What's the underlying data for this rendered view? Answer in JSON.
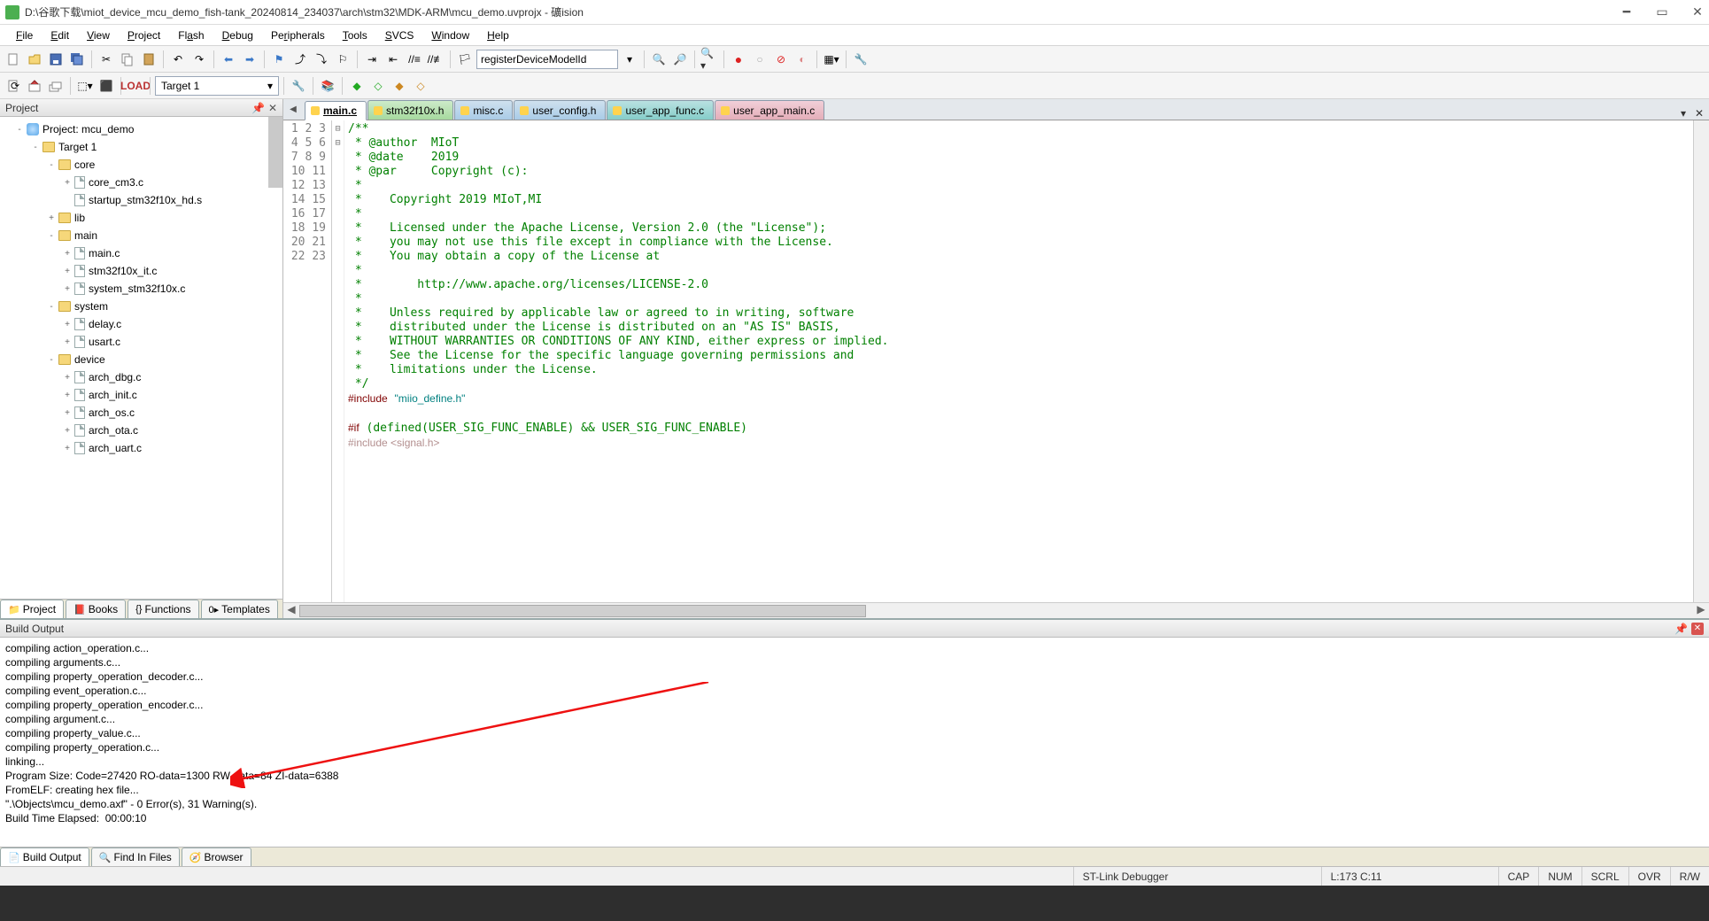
{
  "title": "D:\\谷歌下载\\miot_device_mcu_demo_fish-tank_20240814_234037\\arch\\stm32\\MDK-ARM\\mcu_demo.uvprojx - 礦ision",
  "menu": {
    "file": "File",
    "edit": "Edit",
    "view": "View",
    "project": "Project",
    "flash": "Flash",
    "debug": "Debug",
    "peripherals": "Peripherals",
    "tools": "Tools",
    "svcs": "SVCS",
    "window": "Window",
    "help": "Help"
  },
  "toolbar": {
    "findtext": "registerDeviceModelId"
  },
  "target": {
    "selected": "Target 1"
  },
  "projectPane": {
    "title": "Project",
    "tree": [
      {
        "d": 0,
        "t": "project",
        "exp": "-",
        "label": "Project: mcu_demo"
      },
      {
        "d": 1,
        "t": "target",
        "exp": "-",
        "label": "Target 1"
      },
      {
        "d": 2,
        "t": "folder",
        "exp": "-",
        "label": "core"
      },
      {
        "d": 3,
        "t": "file",
        "exp": "+",
        "label": "core_cm3.c"
      },
      {
        "d": 3,
        "t": "file",
        "exp": "",
        "label": "startup_stm32f10x_hd.s"
      },
      {
        "d": 2,
        "t": "folder",
        "exp": "+",
        "label": "lib"
      },
      {
        "d": 2,
        "t": "folder",
        "exp": "-",
        "label": "main"
      },
      {
        "d": 3,
        "t": "file",
        "exp": "+",
        "label": "main.c"
      },
      {
        "d": 3,
        "t": "file",
        "exp": "+",
        "label": "stm32f10x_it.c"
      },
      {
        "d": 3,
        "t": "file",
        "exp": "+",
        "label": "system_stm32f10x.c"
      },
      {
        "d": 2,
        "t": "folder",
        "exp": "-",
        "label": "system"
      },
      {
        "d": 3,
        "t": "file",
        "exp": "+",
        "label": "delay.c"
      },
      {
        "d": 3,
        "t": "file",
        "exp": "+",
        "label": "usart.c"
      },
      {
        "d": 2,
        "t": "folder",
        "exp": "-",
        "label": "device"
      },
      {
        "d": 3,
        "t": "file",
        "exp": "+",
        "label": "arch_dbg.c"
      },
      {
        "d": 3,
        "t": "file",
        "exp": "+",
        "label": "arch_init.c"
      },
      {
        "d": 3,
        "t": "file",
        "exp": "+",
        "label": "arch_os.c"
      },
      {
        "d": 3,
        "t": "file",
        "exp": "+",
        "label": "arch_ota.c"
      },
      {
        "d": 3,
        "t": "file",
        "exp": "+",
        "label": "arch_uart.c"
      }
    ],
    "tabs": {
      "project": "Project",
      "books": "Books",
      "functions": "Functions",
      "templates": "Templates"
    }
  },
  "editor": {
    "tabs": [
      {
        "name": "main.c",
        "cls": "active tab-green",
        "dot": "#ffd34e"
      },
      {
        "name": "stm32f10x.h",
        "cls": "tab-green",
        "dot": "#ffd34e"
      },
      {
        "name": "misc.c",
        "cls": "tab-blue",
        "dot": "#ffd34e"
      },
      {
        "name": "user_config.h",
        "cls": "tab-blue",
        "dot": "#ffd34e"
      },
      {
        "name": "user_app_func.c",
        "cls": "tab-teal",
        "dot": "#ffd34e"
      },
      {
        "name": "user_app_main.c",
        "cls": "tab-pink",
        "dot": "#ffd34e"
      }
    ],
    "lines": [
      {
        "n": 1,
        "f": "-",
        "h": "/**"
      },
      {
        "n": 2,
        "f": "",
        "h": " * @author  MIoT"
      },
      {
        "n": 3,
        "f": "",
        "h": " * @date    2019"
      },
      {
        "n": 4,
        "f": "",
        "h": " * @par     Copyright (c):"
      },
      {
        "n": 5,
        "f": "",
        "h": " *"
      },
      {
        "n": 6,
        "f": "",
        "h": " *    Copyright 2019 MIoT,MI"
      },
      {
        "n": 7,
        "f": "",
        "h": " *"
      },
      {
        "n": 8,
        "f": "",
        "h": " *    Licensed under the Apache License, Version 2.0 (the \"License\");"
      },
      {
        "n": 9,
        "f": "",
        "h": " *    you may not use this file except in compliance with the License."
      },
      {
        "n": 10,
        "f": "",
        "h": " *    You may obtain a copy of the License at"
      },
      {
        "n": 11,
        "f": "",
        "h": " *"
      },
      {
        "n": 12,
        "f": "",
        "h": " *        http://www.apache.org/licenses/LICENSE-2.0"
      },
      {
        "n": 13,
        "f": "",
        "h": " *"
      },
      {
        "n": 14,
        "f": "",
        "h": " *    Unless required by applicable law or agreed to in writing, software"
      },
      {
        "n": 15,
        "f": "",
        "h": " *    distributed under the License is distributed on an \"AS IS\" BASIS,"
      },
      {
        "n": 16,
        "f": "",
        "h": " *    WITHOUT WARRANTIES OR CONDITIONS OF ANY KIND, either express or implied."
      },
      {
        "n": 17,
        "f": "",
        "h": " *    See the License for the specific language governing permissions and"
      },
      {
        "n": 18,
        "f": "",
        "h": " *    limitations under the License."
      },
      {
        "n": 19,
        "f": "",
        "h": " */"
      },
      {
        "n": 20,
        "f": "",
        "h": "<span class=\"pp\">#include</span> <span class=\"str\">\"miio_define.h\"</span>"
      },
      {
        "n": 21,
        "f": "",
        "h": ""
      },
      {
        "n": 22,
        "f": "-",
        "h": "<span class=\"pp\">#if</span> (defined(USER_SIG_FUNC_ENABLE) && USER_SIG_FUNC_ENABLE)"
      },
      {
        "n": 23,
        "f": "",
        "h": "<span class=\"inact\">#include &lt;signal.h&gt;</span>"
      }
    ]
  },
  "buildOutput": {
    "title": "Build Output",
    "lines": [
      "compiling action_operation.c...",
      "compiling arguments.c...",
      "compiling property_operation_decoder.c...",
      "compiling event_operation.c...",
      "compiling property_operation_encoder.c...",
      "compiling argument.c...",
      "compiling property_value.c...",
      "compiling property_operation.c...",
      "linking...",
      "Program Size: Code=27420 RO-data=1300 RW-data=84 ZI-data=6388",
      "FromELF: creating hex file...",
      "\".\\Objects\\mcu_demo.axf\" - 0 Error(s), 31 Warning(s).",
      "Build Time Elapsed:  00:00:10"
    ],
    "tabs": {
      "buildoutput": "Build Output",
      "findinfiles": "Find In Files",
      "browser": "Browser"
    }
  },
  "statusbar": {
    "debugger": "ST-Link Debugger",
    "pos": "L:173 C:11",
    "caps": "CAP",
    "num": "NUM",
    "scrl": "SCRL",
    "ovr": "OVR",
    "rw": "R/W"
  }
}
